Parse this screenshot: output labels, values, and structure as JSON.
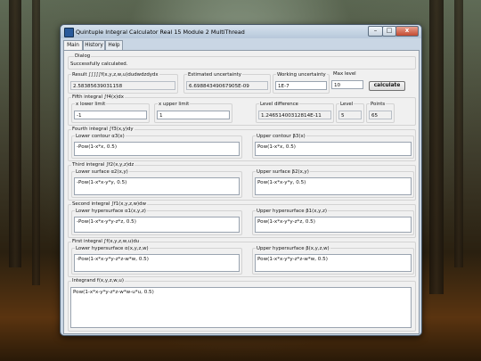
{
  "window": {
    "title": "Quintuple Integral Calculator Real 15 Module 2 MultiThread",
    "controls": {
      "minimize": "–",
      "maximize": "□",
      "close": "x"
    }
  },
  "tabs": [
    "Main",
    "History",
    "Help"
  ],
  "dialog": {
    "label": "Dialog",
    "message": "Successfully calculated."
  },
  "result": {
    "label": "Result ∫∫∫∫∫f(x,y,z,w,u)dudwdzdydx",
    "value": "2.58385639031158"
  },
  "estimated_uncertainty": {
    "label": "Estimated uncertainty",
    "value": "6.69884349067905E-09"
  },
  "working_uncertainty": {
    "label": "Working uncertainty",
    "value": "1E-7"
  },
  "max_level": {
    "label": "Max level",
    "value": "10"
  },
  "calculate_label": "calculate",
  "fifth": {
    "label": "Fifth integral  ∫f4(x)dx",
    "x_lower_label": "x lower limit",
    "x_lower_value": "-1",
    "x_upper_label": "x upper limit",
    "x_upper_value": "1",
    "level_diff_label": "Level difference",
    "level_diff_value": "1.24651400312814E-11",
    "level_label": "Level",
    "level_value": "5",
    "points_label": "Points",
    "points_value": "65"
  },
  "fourth": {
    "label": "Fourth integral  ∫f3(x,y)dy",
    "lower_label": "Lower contour α3(x)",
    "lower_value": "-Pow(1-x*x, 0.5)",
    "upper_label": "Upper contour β3(x)",
    "upper_value": "Pow(1-x*x, 0.5)"
  },
  "third": {
    "label": "Third integral  ∫f2(x,y,z)dz",
    "lower_label": "Lower surface α2(x,y)",
    "lower_value": "-Pow(1-x*x-y*y, 0.5)",
    "upper_label": "Upper surface β2(x,y)",
    "upper_value": "Pow(1-x*x-y*y, 0.5)"
  },
  "second": {
    "label": "Second integral  ∫f1(x,y,z,w)dw",
    "lower_label": "Lower hypersurface α1(x,y,z)",
    "lower_value": "-Pow(1-x*x-y*y-z*z, 0.5)",
    "upper_label": "Upper hypersurface β1(x,y,z)",
    "upper_value": "Pow(1-x*x-y*y-z*z, 0.5)"
  },
  "first": {
    "label": "First integral  ∫f(x,y,z,w,u)du",
    "lower_label": "Lower hypersurface α(x,y,z,w)",
    "lower_value": "-Pow(1-x*x-y*y-z*z-w*w, 0.5)",
    "upper_label": "Upper hypersurface β(x,y,z,w)",
    "upper_value": "Pow(1-x*x-y*y-z*z-w*w, 0.5)"
  },
  "integrand": {
    "label": "Integrand f(x,y,z,w,u)",
    "value": "Pow(1-x*x-y*y-z*z-w*w-u*u, 0.5)"
  }
}
